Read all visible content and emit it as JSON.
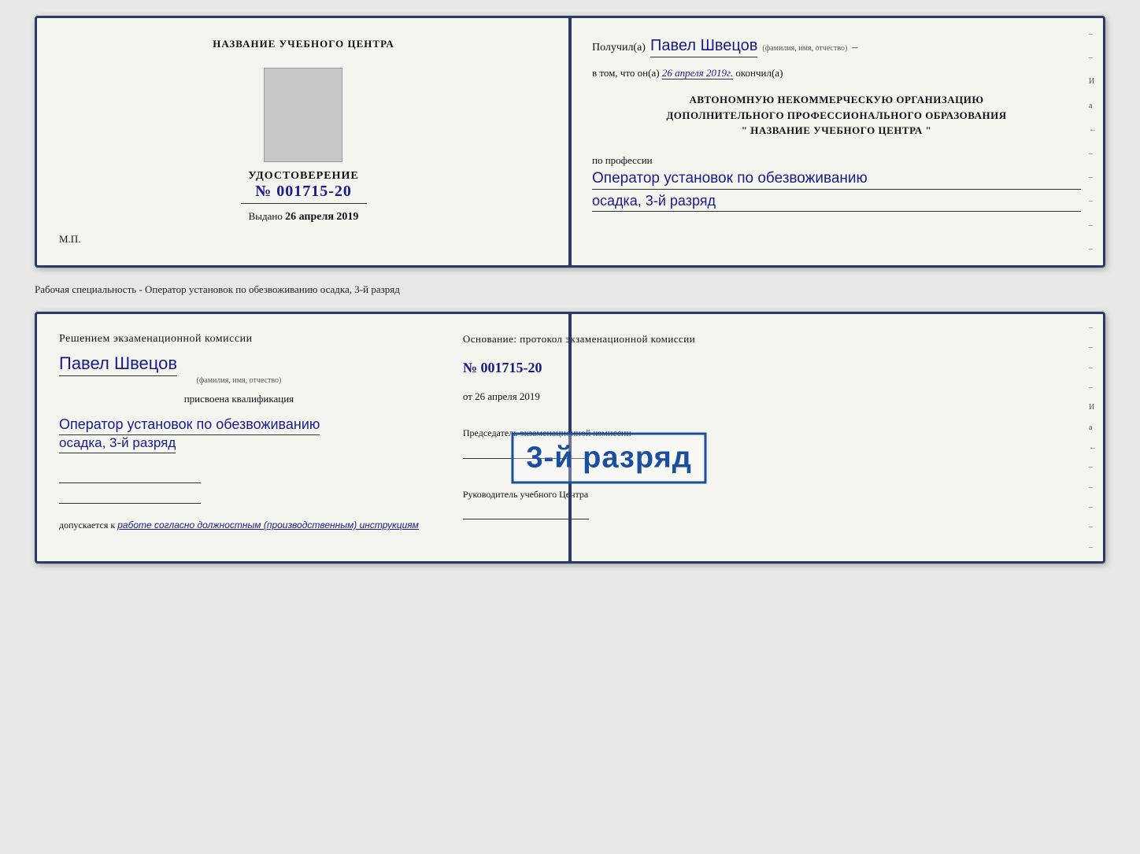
{
  "doc1": {
    "left": {
      "training_center_title": "НАЗВАНИЕ УЧЕБНОГО ЦЕНТРА",
      "cert_label": "УДОСТОВЕРЕНИЕ",
      "cert_number": "№ 001715-20",
      "issued_label": "Выдано",
      "issued_date": "26 апреля 2019",
      "mp_label": "М.П."
    },
    "right": {
      "received_prefix": "Получил(а)",
      "recipient_name": "Павел Швецов",
      "fio_hint": "(фамилия, имя, отчество)",
      "dash": "–",
      "completed_prefix": "в том, что он(а)",
      "completed_date": "26 апреля 2019г.",
      "completed_suffix": "окончил(а)",
      "org_line1": "АВТОНОМНУЮ НЕКОММЕРЧЕСКУЮ ОРГАНИЗАЦИЮ",
      "org_line2": "ДОПОЛНИТЕЛЬНОГО ПРОФЕССИОНАЛЬНОГО ОБРАЗОВАНИЯ",
      "org_line3": "\" НАЗВАНИЕ УЧЕБНОГО ЦЕНТРА \"",
      "profession_label": "по профессии",
      "profession_value": "Оператор установок по обезвоживанию",
      "qualification_value": "осадка, 3-й разряд"
    }
  },
  "separator": {
    "text": "Рабочая специальность - Оператор установок по обезвоживанию осадка, 3-й разряд"
  },
  "doc2": {
    "left": {
      "decision_title": "Решением экзаменационной комиссии",
      "person_name": "Павел Швецов",
      "fio_hint": "(фамилия, имя, отчество)",
      "assigned_label": "присвоена квалификация",
      "profession_value": "Оператор установок по обезвоживанию",
      "rank_value": "осадка, 3-й разряд",
      "allowed_prefix": "допускается к",
      "allowed_value": "работе согласно должностным (производственным) инструкциям"
    },
    "right": {
      "basis_title": "Основание: протокол экзаменационной комиссии",
      "basis_number": "№ 001715-20",
      "basis_date_prefix": "от",
      "basis_date": "26 апреля 2019",
      "chairman_label": "Председатель экзаменационной комиссии",
      "director_label": "Руководитель учебного Центра"
    },
    "stamp": {
      "text": "3-й разряд"
    }
  }
}
